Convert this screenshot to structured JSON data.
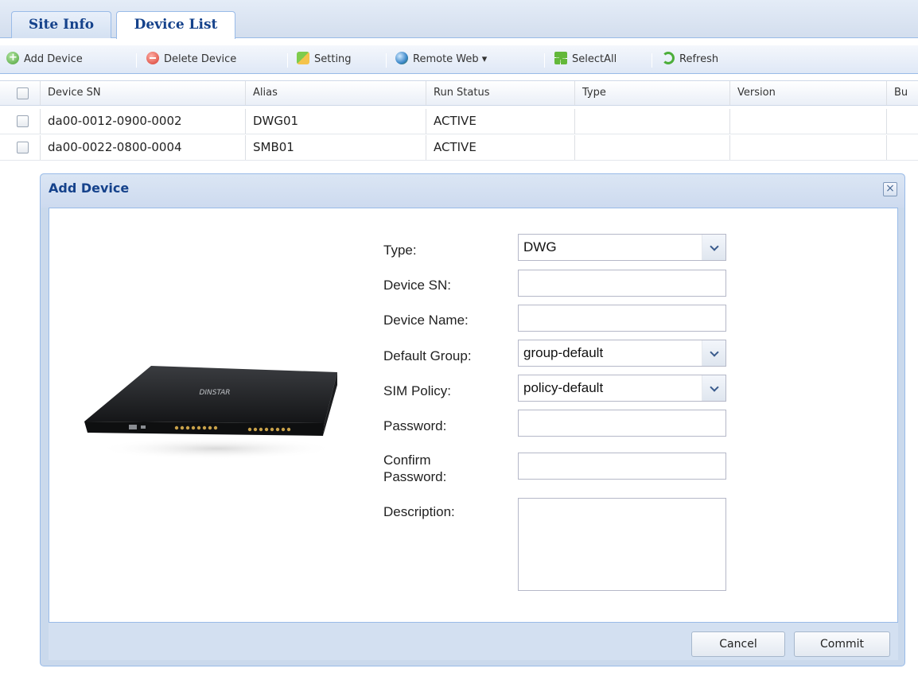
{
  "tabs": [
    {
      "label": "Site Info"
    },
    {
      "label": "Device List"
    }
  ],
  "toolbar": {
    "add_device": "Add Device",
    "delete_device": "Delete Device",
    "setting": "Setting",
    "remote_web": "Remote Web ▾",
    "select_all": "SelectAll",
    "refresh": "Refresh"
  },
  "grid": {
    "columns": [
      "Device SN",
      "Alias",
      "Run Status",
      "Type",
      "Version",
      "Bu"
    ],
    "rows": [
      {
        "sn": "da00-0012-0900-0002",
        "alias": "DWG01",
        "status": "ACTIVE",
        "type": "",
        "version": ""
      },
      {
        "sn": "da00-0022-0800-0004",
        "alias": "SMB01",
        "status": "ACTIVE",
        "type": "",
        "version": ""
      }
    ]
  },
  "dialog": {
    "title": "Add Device",
    "close_glyph": "×",
    "device_brand": "DINSTAR",
    "labels": {
      "type": "Type:",
      "device_sn": "Device SN:",
      "device_name": "Device Name:",
      "default_group": "Default Group:",
      "sim_policy": "SIM Policy:",
      "password": "Password:",
      "confirm_password": "Confirm Password:",
      "description": "Description:"
    },
    "values": {
      "type": "DWG",
      "device_sn": "",
      "device_name": "",
      "default_group": "group-default",
      "sim_policy": "policy-default",
      "password": "",
      "confirm_password": "",
      "description": ""
    },
    "buttons": {
      "cancel": "Cancel",
      "commit": "Commit"
    }
  },
  "colors": {
    "header_text": "#15428b",
    "border": "#99bbe8",
    "panel_bg": "#cad9ec"
  }
}
